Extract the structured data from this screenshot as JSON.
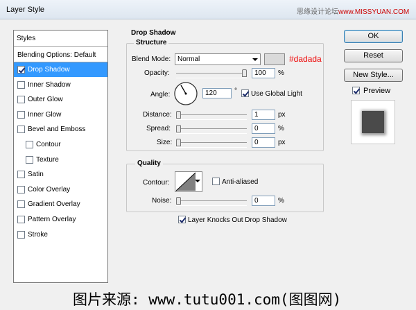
{
  "window": {
    "title": "Layer Style"
  },
  "watermark_top": {
    "prefix": "思缘设计论坛",
    "site": "www.MISSYUAN.COM"
  },
  "styles_list": {
    "header": "Styles",
    "blending_options": "Blending Options: Default",
    "items": [
      {
        "label": "Drop Shadow",
        "checked": true,
        "selected": true,
        "indent": false
      },
      {
        "label": "Inner Shadow",
        "checked": false,
        "selected": false,
        "indent": false
      },
      {
        "label": "Outer Glow",
        "checked": false,
        "selected": false,
        "indent": false
      },
      {
        "label": "Inner Glow",
        "checked": false,
        "selected": false,
        "indent": false
      },
      {
        "label": "Bevel and Emboss",
        "checked": false,
        "selected": false,
        "indent": false
      },
      {
        "label": "Contour",
        "checked": false,
        "selected": false,
        "indent": true
      },
      {
        "label": "Texture",
        "checked": false,
        "selected": false,
        "indent": true
      },
      {
        "label": "Satin",
        "checked": false,
        "selected": false,
        "indent": false
      },
      {
        "label": "Color Overlay",
        "checked": false,
        "selected": false,
        "indent": false
      },
      {
        "label": "Gradient Overlay",
        "checked": false,
        "selected": false,
        "indent": false
      },
      {
        "label": "Pattern Overlay",
        "checked": false,
        "selected": false,
        "indent": false
      },
      {
        "label": "Stroke",
        "checked": false,
        "selected": false,
        "indent": false
      }
    ]
  },
  "drop_shadow": {
    "title": "Drop Shadow",
    "structure": {
      "label": "Structure",
      "blend_mode_label": "Blend Mode:",
      "blend_mode_value": "Normal",
      "color_hex": "#dadada",
      "color_swatch": "#dadada",
      "opacity_label": "Opacity:",
      "opacity_value": "100",
      "opacity_unit": "%",
      "opacity_fraction": 1.0,
      "angle_label": "Angle:",
      "angle_value": "120",
      "angle_unit": "°",
      "angle_degrees": 120,
      "use_global_light_label": "Use Global Light",
      "use_global_light_checked": true,
      "distance_label": "Distance:",
      "distance_value": "1",
      "distance_unit": "px",
      "distance_fraction": 0.0,
      "spread_label": "Spread:",
      "spread_value": "0",
      "spread_unit": "%",
      "spread_fraction": 0.0,
      "size_label": "Size:",
      "size_value": "0",
      "size_unit": "px",
      "size_fraction": 0.0
    },
    "quality": {
      "label": "Quality",
      "contour_label": "Contour:",
      "anti_aliased_label": "Anti-aliased",
      "anti_aliased_checked": false,
      "noise_label": "Noise:",
      "noise_value": "0",
      "noise_unit": "%",
      "noise_fraction": 0.0
    },
    "knocks_out_label": "Layer Knocks Out Drop Shadow",
    "knocks_out_checked": true
  },
  "buttons": {
    "ok": "OK",
    "reset": "Reset",
    "new_style": "New Style...",
    "preview_label": "Preview",
    "preview_checked": true
  },
  "bottom_watermark": "图片来源: www.tutu001.com(图图网)"
}
